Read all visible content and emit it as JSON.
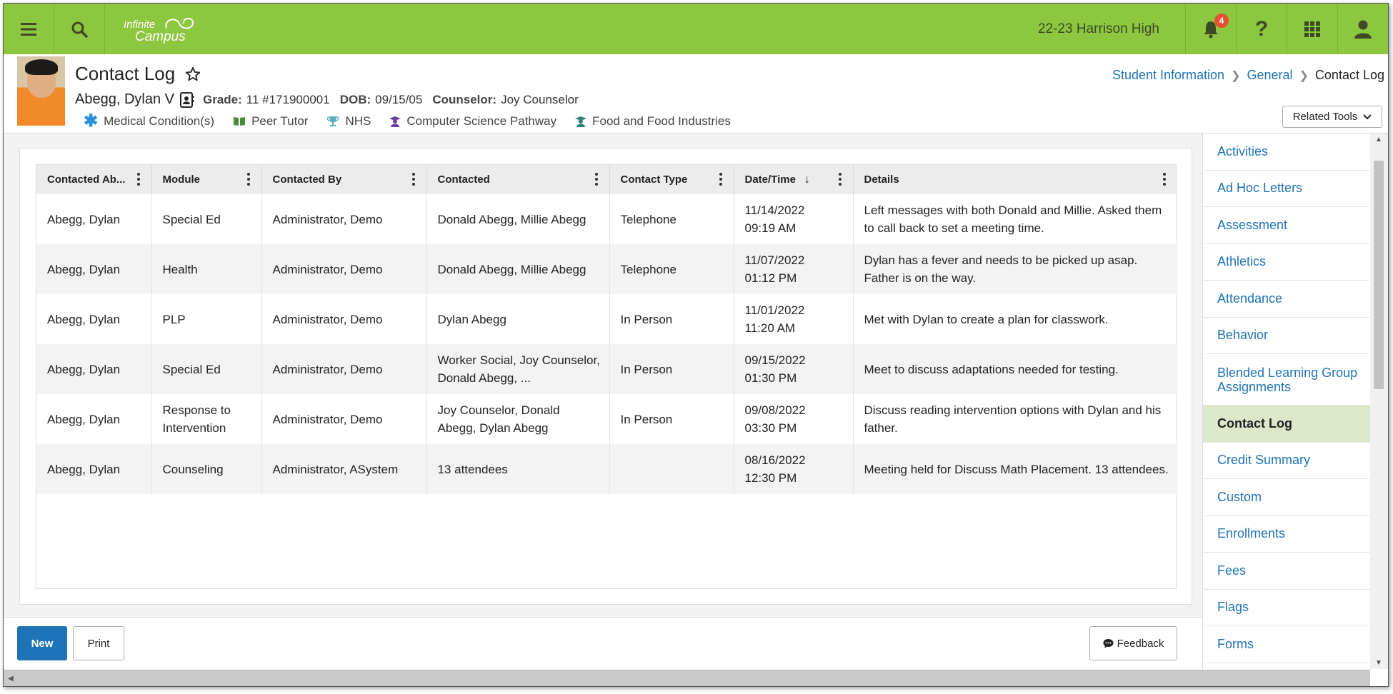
{
  "topbar": {
    "logo_line1": "Infinite",
    "logo_line2": "Campus",
    "school": "22-23 Harrison High",
    "notification_count": "4",
    "icons": [
      "menu-icon",
      "search-icon",
      "bell-icon",
      "help-icon",
      "apps-grid-icon",
      "user-icon"
    ],
    "accent_color": "#8dc63f"
  },
  "header": {
    "title": "Contact Log",
    "breadcrumb": [
      "Student Information",
      "General",
      "Contact Log"
    ],
    "student_name": "Abegg, Dylan V",
    "grade_label": "Grade:",
    "grade_value": "11 #171900001",
    "dob_label": "DOB:",
    "dob_value": "09/15/05",
    "counselor_label": "Counselor:",
    "counselor_value": "Joy Counselor",
    "flags": [
      {
        "label": "Medical Condition(s)",
        "icon": "asterisk-icon"
      },
      {
        "label": "Peer Tutor",
        "icon": "book-icon"
      },
      {
        "label": "NHS",
        "icon": "trophy-icon"
      },
      {
        "label": "Computer Science Pathway",
        "icon": "graduate-icon"
      },
      {
        "label": "Food and Food Industries",
        "icon": "graduate-icon"
      }
    ],
    "related_tools": "Related Tools"
  },
  "table": {
    "columns": [
      "Contacted Ab...",
      "Module",
      "Contacted By",
      "Contacted",
      "Contact Type",
      "Date/Time",
      "Details"
    ],
    "rows": [
      {
        "about": "Abegg, Dylan",
        "module": "Special Ed",
        "by": "Administrator, Demo",
        "contacted": "Donald Abegg, Millie Abegg",
        "type": "Telephone",
        "date": "11/14/2022",
        "time": "09:19 AM",
        "details": "Left messages with both Donald and Millie. Asked them to call back to set a meeting time."
      },
      {
        "about": "Abegg, Dylan",
        "module": "Health",
        "by": "Administrator, Demo",
        "contacted": "Donald Abegg, Millie Abegg",
        "type": "Telephone",
        "date": "11/07/2022",
        "time": "01:12 PM",
        "details": "Dylan has a fever and needs to be picked up asap. Father is on the way."
      },
      {
        "about": "Abegg, Dylan",
        "module": "PLP",
        "by": "Administrator, Demo",
        "contacted": "Dylan Abegg",
        "type": "In Person",
        "date": "11/01/2022",
        "time": "11:20 AM",
        "details": "Met with Dylan to create a plan for classwork."
      },
      {
        "about": "Abegg, Dylan",
        "module": "Special Ed",
        "by": "Administrator, Demo",
        "contacted": "Worker Social, Joy Counselor, Donald Abegg, ...",
        "type": "In Person",
        "date": "09/15/2022",
        "time": "01:30 PM",
        "details": "Meet to discuss adaptations needed for testing."
      },
      {
        "about": "Abegg, Dylan",
        "module": "Response to Intervention",
        "by": "Administrator, Demo",
        "contacted": "Joy Counselor, Donald Abegg, Dylan Abegg",
        "type": "In Person",
        "date": "09/08/2022",
        "time": "03:30 PM",
        "details": "Discuss reading intervention options with Dylan and his father."
      },
      {
        "about": "Abegg, Dylan",
        "module": "Counseling",
        "by": "Administrator, ASystem",
        "contacted": "13 attendees",
        "type": "",
        "date": "08/16/2022",
        "time": "12:30 PM",
        "details": "Meeting held for Discuss Math Placement. 13 attendees."
      }
    ]
  },
  "sidenav": {
    "items": [
      "Activities",
      "Ad Hoc Letters",
      "Assessment",
      "Athletics",
      "Attendance",
      "Behavior",
      "Blended Learning Group Assignments",
      "Contact Log",
      "Credit Summary",
      "Custom",
      "Enrollments",
      "Fees",
      "Flags",
      "Forms"
    ],
    "active": "Contact Log"
  },
  "footer": {
    "new_label": "New",
    "print_label": "Print",
    "feedback_label": "Feedback"
  }
}
